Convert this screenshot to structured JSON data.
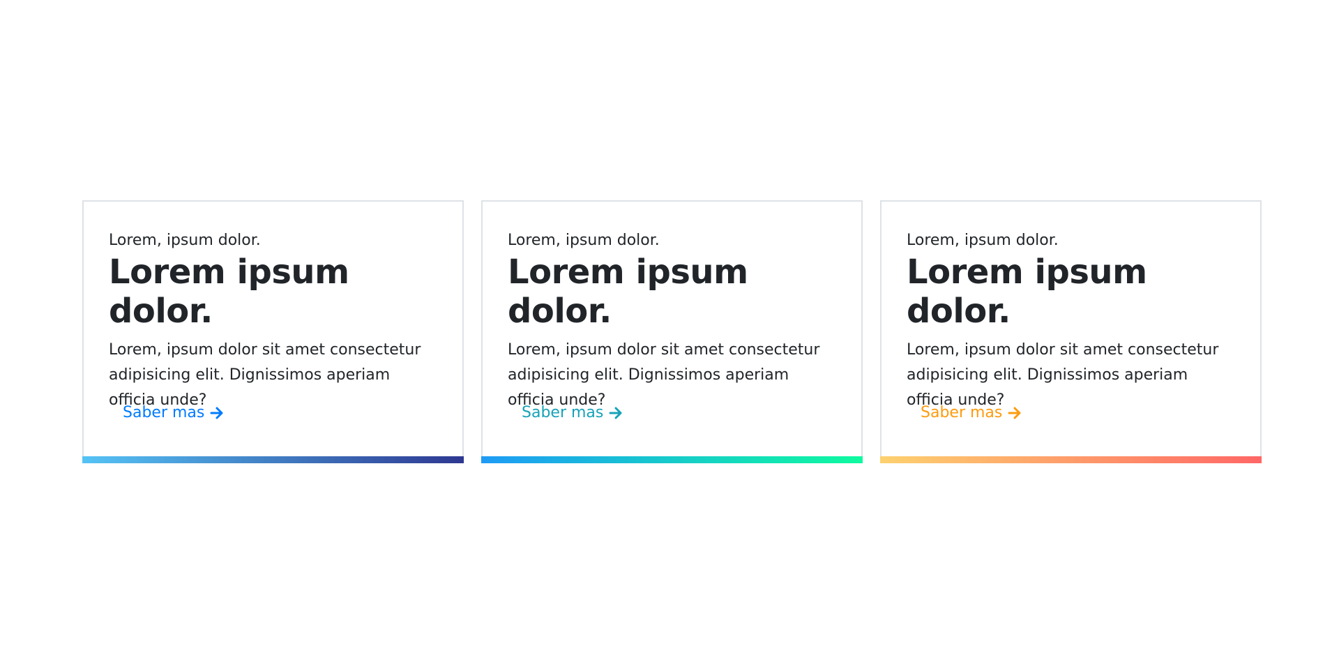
{
  "cards": [
    {
      "eyebrow": "Lorem, ipsum dolor.",
      "title": "Lorem ipsum dolor.",
      "text": "Lorem, ipsum dolor sit amet consectetur adipisicing elit. Dignissimos aperiam officia unde?",
      "link": "Saber mas",
      "link_color": "#007bff",
      "gradient": [
        "#55c3f5",
        "#2e3891"
      ],
      "icon": "arrow-right-icon"
    },
    {
      "eyebrow": "Lorem, ipsum dolor.",
      "title": "Lorem ipsum dolor.",
      "text": "Lorem, ipsum dolor sit amet consectetur adipisicing elit. Dignissimos aperiam officia unde?",
      "link": "Saber mas",
      "link_color": "#17a2b8",
      "gradient": [
        "#1e9bf5",
        "#0ffa9f"
      ],
      "icon": "arrow-right-icon"
    },
    {
      "eyebrow": "Lorem, ipsum dolor.",
      "title": "Lorem ipsum dolor.",
      "text": "Lorem, ipsum dolor sit amet consectetur adipisicing elit. Dignissimos aperiam officia unde?",
      "link": "Saber mas",
      "link_color": "#fd9b0f",
      "gradient": [
        "#fdd16f",
        "#ff6766"
      ],
      "icon": "arrow-right-icon"
    }
  ]
}
